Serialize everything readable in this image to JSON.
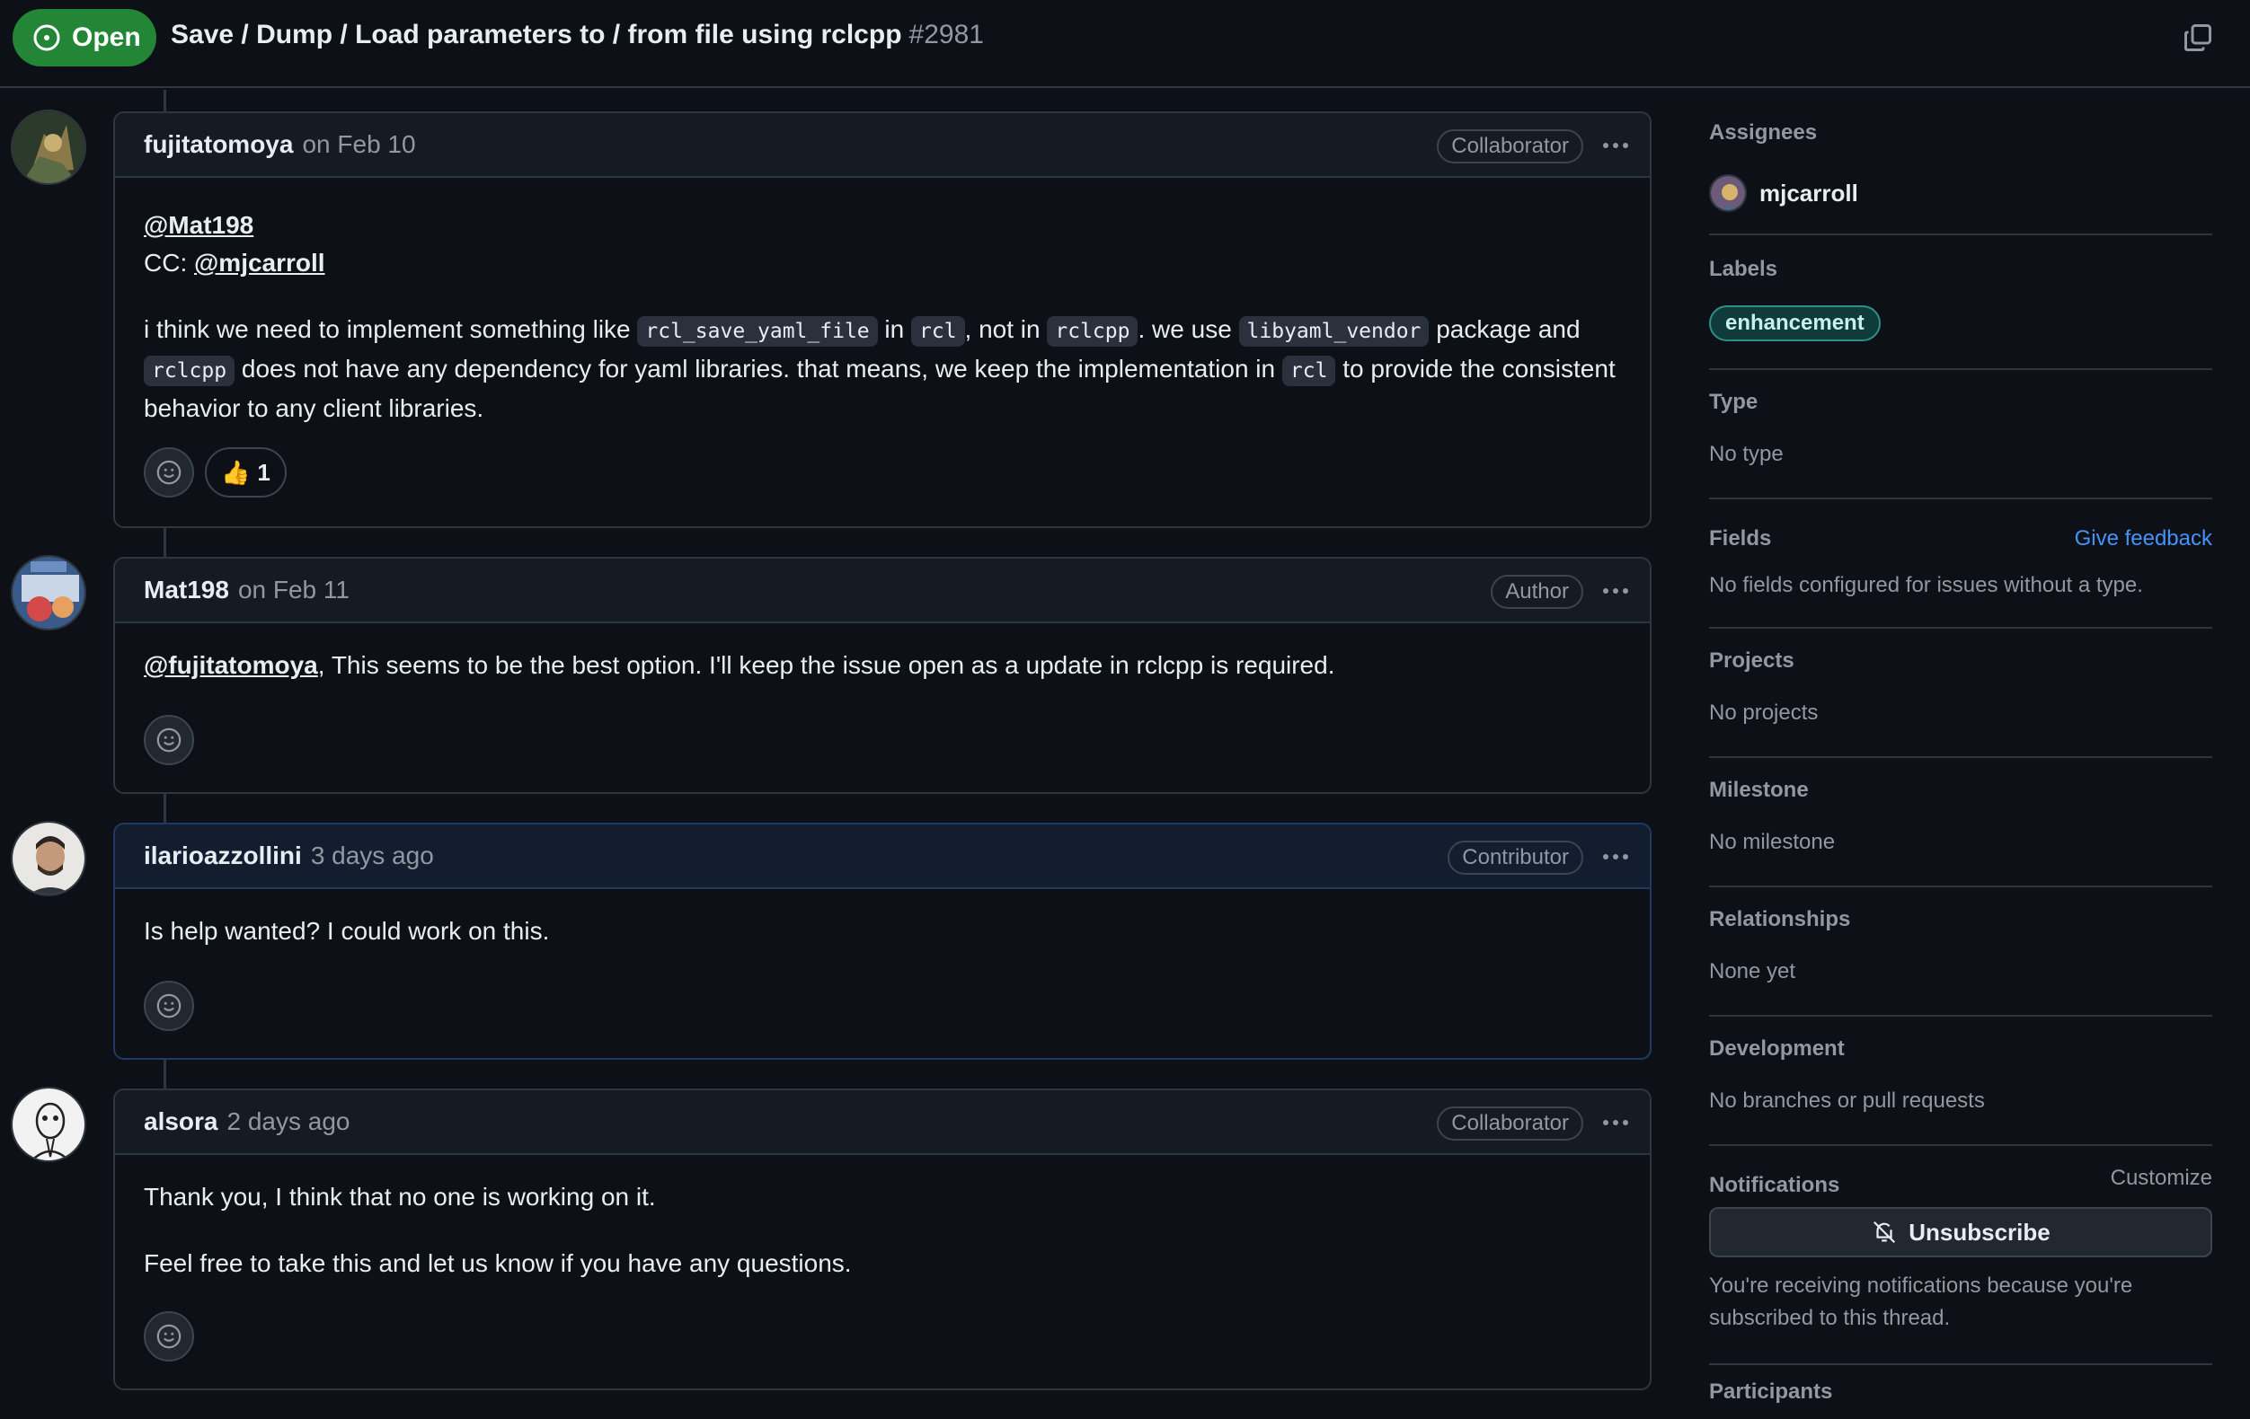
{
  "header": {
    "state_label": "Open",
    "title": "Save / Dump / Load parameters to / from file using rclcpp",
    "number": "#2981"
  },
  "comments": [
    {
      "author": "fujitatomoya",
      "date": "on Feb 10",
      "role": "Collaborator",
      "mention_1": "@Mat198",
      "cc_prefix": "CC: ",
      "mention_2": "@mjcarroll",
      "p1": "i think we need to implement something like ",
      "code1": "rcl_save_yaml_file",
      "p2": " in ",
      "code2": "rcl",
      "p3": ", not in ",
      "code3": "rclcpp",
      "p4": ". we use ",
      "code4": "libyaml_vendor",
      "p5": " package and ",
      "code5": "rclcpp",
      "p6": " does not have any dependency for yaml libraries. that means, we keep the implementation in ",
      "code6": "rcl",
      "p7": " to provide the consistent behavior to any client libraries.",
      "reaction_emoji": "👍",
      "reaction_count": "1"
    },
    {
      "author": "Mat198",
      "date": "on Feb 11",
      "role": "Author",
      "mention": "@fujitatomoya",
      "text": ", This seems to be the best option. I'll keep the issue open as a update in rclcpp is required."
    },
    {
      "author": "ilarioazzollini",
      "date": "3 days ago",
      "role": "Contributor",
      "text": "Is help wanted? I could work on this."
    },
    {
      "author": "alsora",
      "date": "2 days ago",
      "role": "Collaborator",
      "text1": "Thank you, I think that no one is working on it.",
      "text2": "Feel free to take this and let us know if you have any questions."
    }
  ],
  "sidebar": {
    "assignees": {
      "heading": "Assignees",
      "name": "mjcarroll"
    },
    "labels": {
      "heading": "Labels",
      "label": "enhancement"
    },
    "type": {
      "heading": "Type",
      "value": "No type"
    },
    "fields": {
      "heading": "Fields",
      "link": "Give feedback",
      "value": "No fields configured for issues without a type."
    },
    "projects": {
      "heading": "Projects",
      "value": "No projects"
    },
    "milestone": {
      "heading": "Milestone",
      "value": "No milestone"
    },
    "relationships": {
      "heading": "Relationships",
      "value": "None yet"
    },
    "development": {
      "heading": "Development",
      "value": "No branches or pull requests"
    },
    "notifications": {
      "heading": "Notifications",
      "customize": "Customize",
      "button": "Unsubscribe",
      "text": "You're receiving notifications because you're subscribed to this thread."
    },
    "participants": {
      "heading": "Participants"
    }
  },
  "colors": {
    "background": "#0d1117",
    "open_green": "#238636",
    "link_blue": "#4493f8",
    "border": "#30363d",
    "label_teal": "#2f8f88"
  },
  "icons": [
    "issue-opened-icon",
    "copy-icon",
    "kebab-icon",
    "smiley-icon",
    "bell-slash-icon"
  ]
}
